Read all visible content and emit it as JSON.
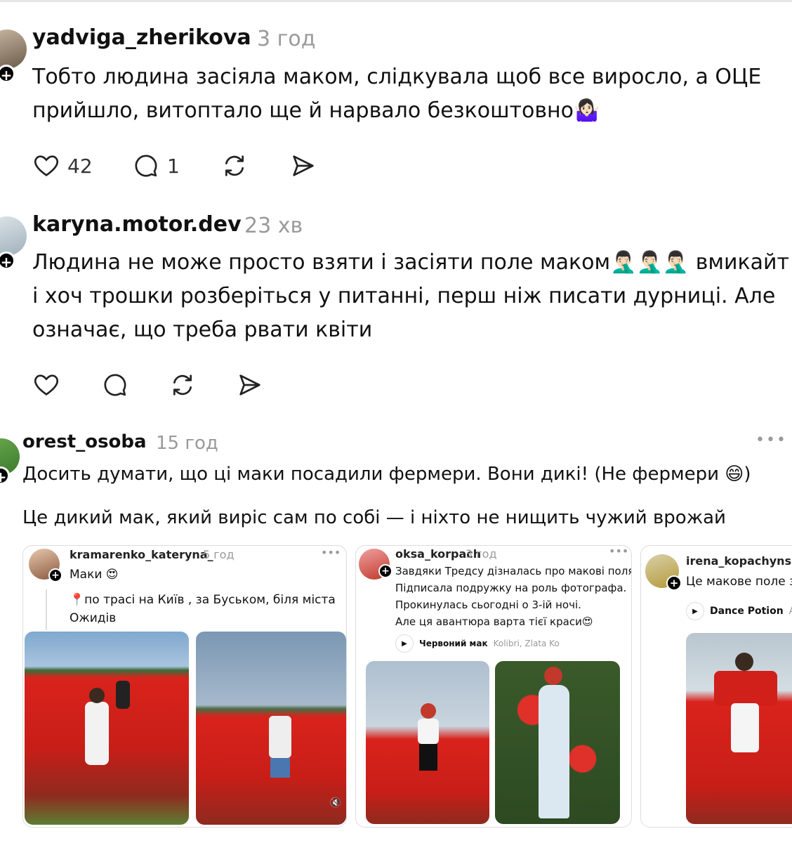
{
  "posts": [
    {
      "username": "yadviga_zherikova",
      "time": "3 год",
      "text_lines": [
        "Тобто людина засіяла маком, слідкувала щоб все виросло, а ОЦЕ",
        "прийшло, витоптало ще й нарвало безкоштовно🤷🏻‍♀️"
      ],
      "likes": "42",
      "replies": "1"
    },
    {
      "username": "karyna.motor.dev",
      "time": "23 хв",
      "text_lines": [
        "Людина не може просто взяти і засіяти поле маком🤦🏻‍♂️🤦🏻‍♂️🤦🏻‍♂️ вмикайт",
        "і хоч трошки розберіться у питанні, перш ніж писати дурниці. Але",
        "означає, що треба рвати квіти"
      ]
    },
    {
      "username": "orest_osoba",
      "time": "15 год",
      "more": "•••",
      "text_line1": "Досить думати, що ці маки посадили фермери. Вони дикі! (Не фермери 😄)",
      "text_line2": "Це дикий мак, який виріс сам по собі — і ніхто не нищить чужий врожай"
    }
  ],
  "embedded": [
    {
      "username": "kramarenko_kateryna_",
      "time": "5 год",
      "more": "•••",
      "lines": [
        "Маки 😍"
      ],
      "quote_lines": [
        "📍по трасі на Київ , за Буськом, біля міста",
        "Ожидів"
      ]
    },
    {
      "username": "oksa_korpach",
      "time": "3 год",
      "more": "•••",
      "lines": [
        "Завдяки Тредсу дізналась про макові поля.",
        "Підписала подружку на роль фотографа.",
        "Прокинулась сьогодні о 3-ій ночі.",
        " Але ця авантюра варта тієї краси😍"
      ],
      "music_title": "Червоний мак",
      "music_artist": "Kolibri, Zlata Ko"
    },
    {
      "username": "irena_kopachynska",
      "lines": [
        "Це макове поле з"
      ],
      "music_title": "Dance Potion",
      "music_artist": "AS"
    }
  ],
  "colors": {
    "poppy_red": "#d9231c",
    "sky": "#8fb3d4",
    "muted": "#9a9a9a"
  }
}
